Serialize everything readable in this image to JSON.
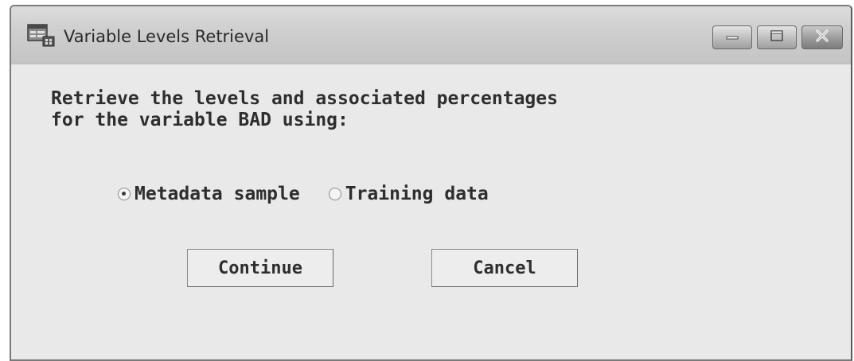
{
  "window": {
    "title": "Variable Levels Retrieval",
    "icon": "sas-app-icon",
    "controls": [
      "minimize-icon",
      "maximize-icon",
      "close-icon"
    ]
  },
  "dialog": {
    "prompt_line1": "Retrieve the levels and associated percentages",
    "prompt_line2": "for the variable BAD using:",
    "options": [
      {
        "label": "Metadata sample",
        "selected": true
      },
      {
        "label": "Training data",
        "selected": false
      }
    ],
    "continue_label": "Continue",
    "cancel_label": "Cancel"
  },
  "colors": {
    "titlebar": "#cfcfcf",
    "content_bg": "#e9e9e9",
    "text": "#2e2e2e"
  }
}
